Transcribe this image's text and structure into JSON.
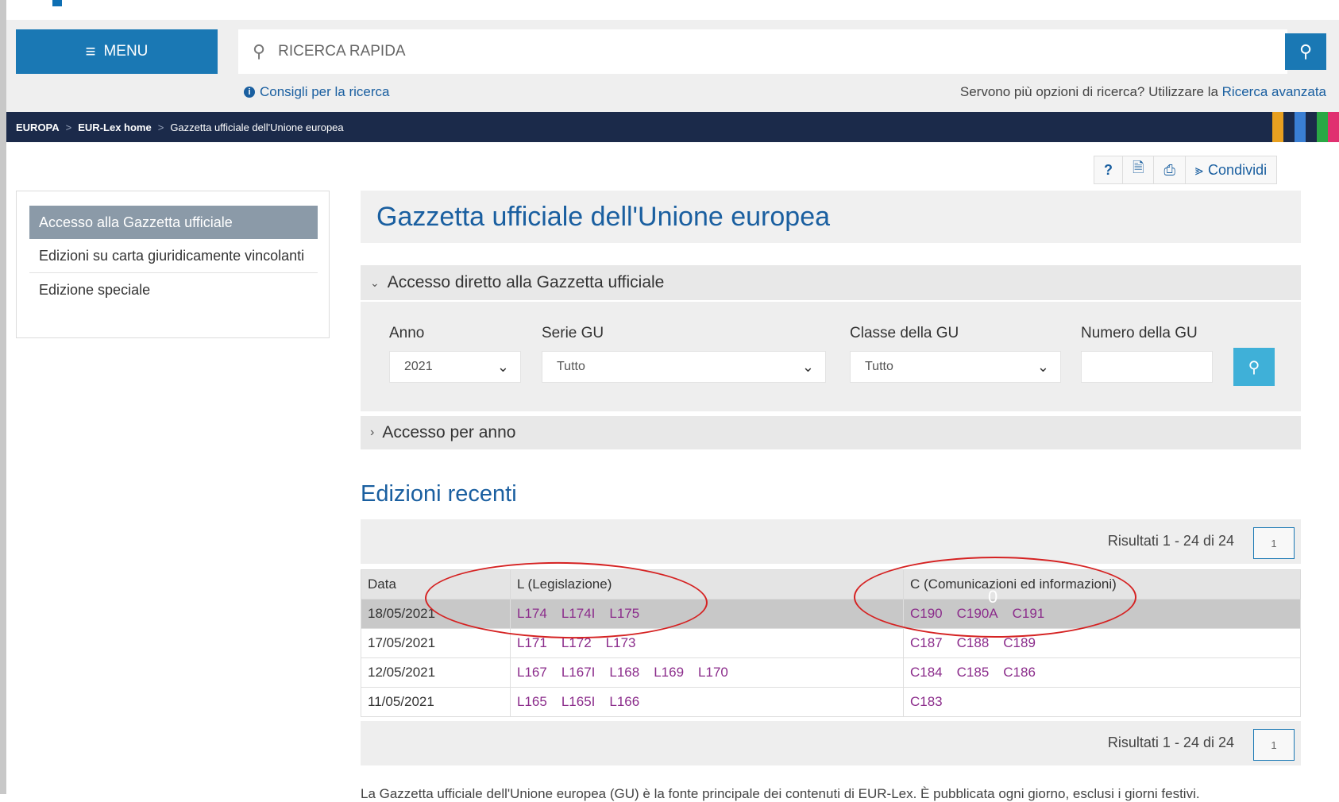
{
  "header": {
    "menu_label": "MENU",
    "search_placeholder": "RICERCA RAPIDA",
    "tips_label": "Consigli per la ricerca",
    "advanced_prefix": "Servono più opzioni di ricerca? Utilizzare la ",
    "advanced_link": "Ricerca avanzata"
  },
  "breadcrumb": {
    "items": [
      "EUROPA",
      "EUR-Lex home",
      "Gazzetta ufficiale dell'Unione europea"
    ]
  },
  "toolbar": {
    "help_label": "?",
    "share_label": "Condividi"
  },
  "sidenav": {
    "items": [
      {
        "label": "Accesso alla Gazzetta ufficiale"
      },
      {
        "label": "Edizioni su carta giuridicamente vincolanti"
      },
      {
        "label": "Edizione speciale"
      }
    ]
  },
  "main": {
    "title": "Gazzetta ufficiale dell'Unione europea",
    "direct_access": {
      "title": "Accesso diretto alla Gazzetta ufficiale",
      "year_label": "Anno",
      "year_value": "2021",
      "series_label": "Serie GU",
      "series_value": "Tutto",
      "class_label": "Classe della GU",
      "class_value": "Tutto",
      "number_label": "Numero della GU",
      "number_value": ""
    },
    "by_year_title": "Accesso per anno",
    "recent_title": "Edizioni recenti",
    "results_text": "Risultati 1 - 24 di 24",
    "page_number": "1",
    "table": {
      "headers": [
        "Data",
        "L (Legislazione)",
        "C (Comunicazioni ed informazioni)"
      ],
      "rows": [
        {
          "date": "18/05/2021",
          "l": [
            "L174",
            "L174I",
            "L175"
          ],
          "c": [
            "C190",
            "C190A",
            "C191"
          ],
          "highlighted": true
        },
        {
          "date": "17/05/2021",
          "l": [
            "L171",
            "L172",
            "L173"
          ],
          "c": [
            "C187",
            "C188",
            "C189"
          ],
          "highlighted": false
        },
        {
          "date": "12/05/2021",
          "l": [
            "L167",
            "L167I",
            "L168",
            "L169",
            "L170"
          ],
          "c": [
            "C184",
            "C185",
            "C186"
          ],
          "highlighted": false
        },
        {
          "date": "11/05/2021",
          "l": [
            "L165",
            "L165I",
            "L166"
          ],
          "c": [
            "C183"
          ],
          "highlighted": false
        }
      ]
    },
    "annotation_mark": "0",
    "footer_text": "La Gazzetta ufficiale dell'Unione europea (GU) è la fonte principale dei contenuti di EUR-Lex. È pubblicata ogni giorno, esclusi i giorni festivi."
  },
  "colors": {
    "accent": "#1a78b4",
    "breadcrumb_bg": "#1b2a4a",
    "link": "#1a5fa0",
    "doc_link": "#8b2c8b",
    "annotation": "#d52222"
  },
  "icons": [
    "menu-icon",
    "search-icon",
    "info-icon",
    "help-icon",
    "pdf-icon",
    "print-icon",
    "share-icon",
    "chevron-down-icon",
    "chevron-right-icon"
  ]
}
